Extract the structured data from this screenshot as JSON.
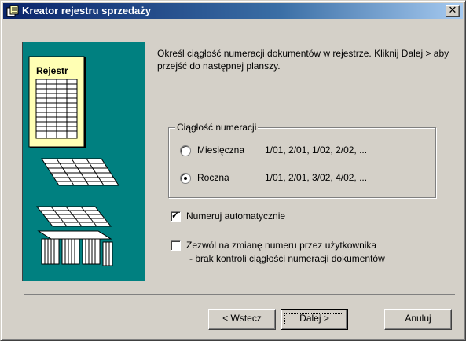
{
  "window": {
    "title": "Kreator rejestru sprzedaży",
    "close_glyph": "✕"
  },
  "illustration": {
    "label": "Rejestr",
    "colors": {
      "background": "#008080",
      "card": "#ffffb4"
    }
  },
  "intro_text": "Określ ciągłość numeracji dokumentów w rejestrze. Kliknij Dalej > aby przejść do następnej planszy.",
  "numbering_group": {
    "label": "Ciągłość numeracji",
    "options": [
      {
        "label": "Miesięczna",
        "example": "1/01, 2/01, 1/02, 2/02, ...",
        "selected": false
      },
      {
        "label": "Roczna",
        "example": "1/01, 2/01, 3/02, 4/02, ...",
        "selected": true
      }
    ]
  },
  "auto_numbering": {
    "label": "Numeruj automatycznie",
    "checked": true
  },
  "allow_change": {
    "label": "Zezwól na zmianę numeru przez użytkownika",
    "note": "- brak kontroli ciągłości numeracji dokumentów",
    "checked": false
  },
  "buttons": {
    "back": "< Wstecz",
    "next": "Dalej >",
    "cancel": "Anuluj"
  }
}
